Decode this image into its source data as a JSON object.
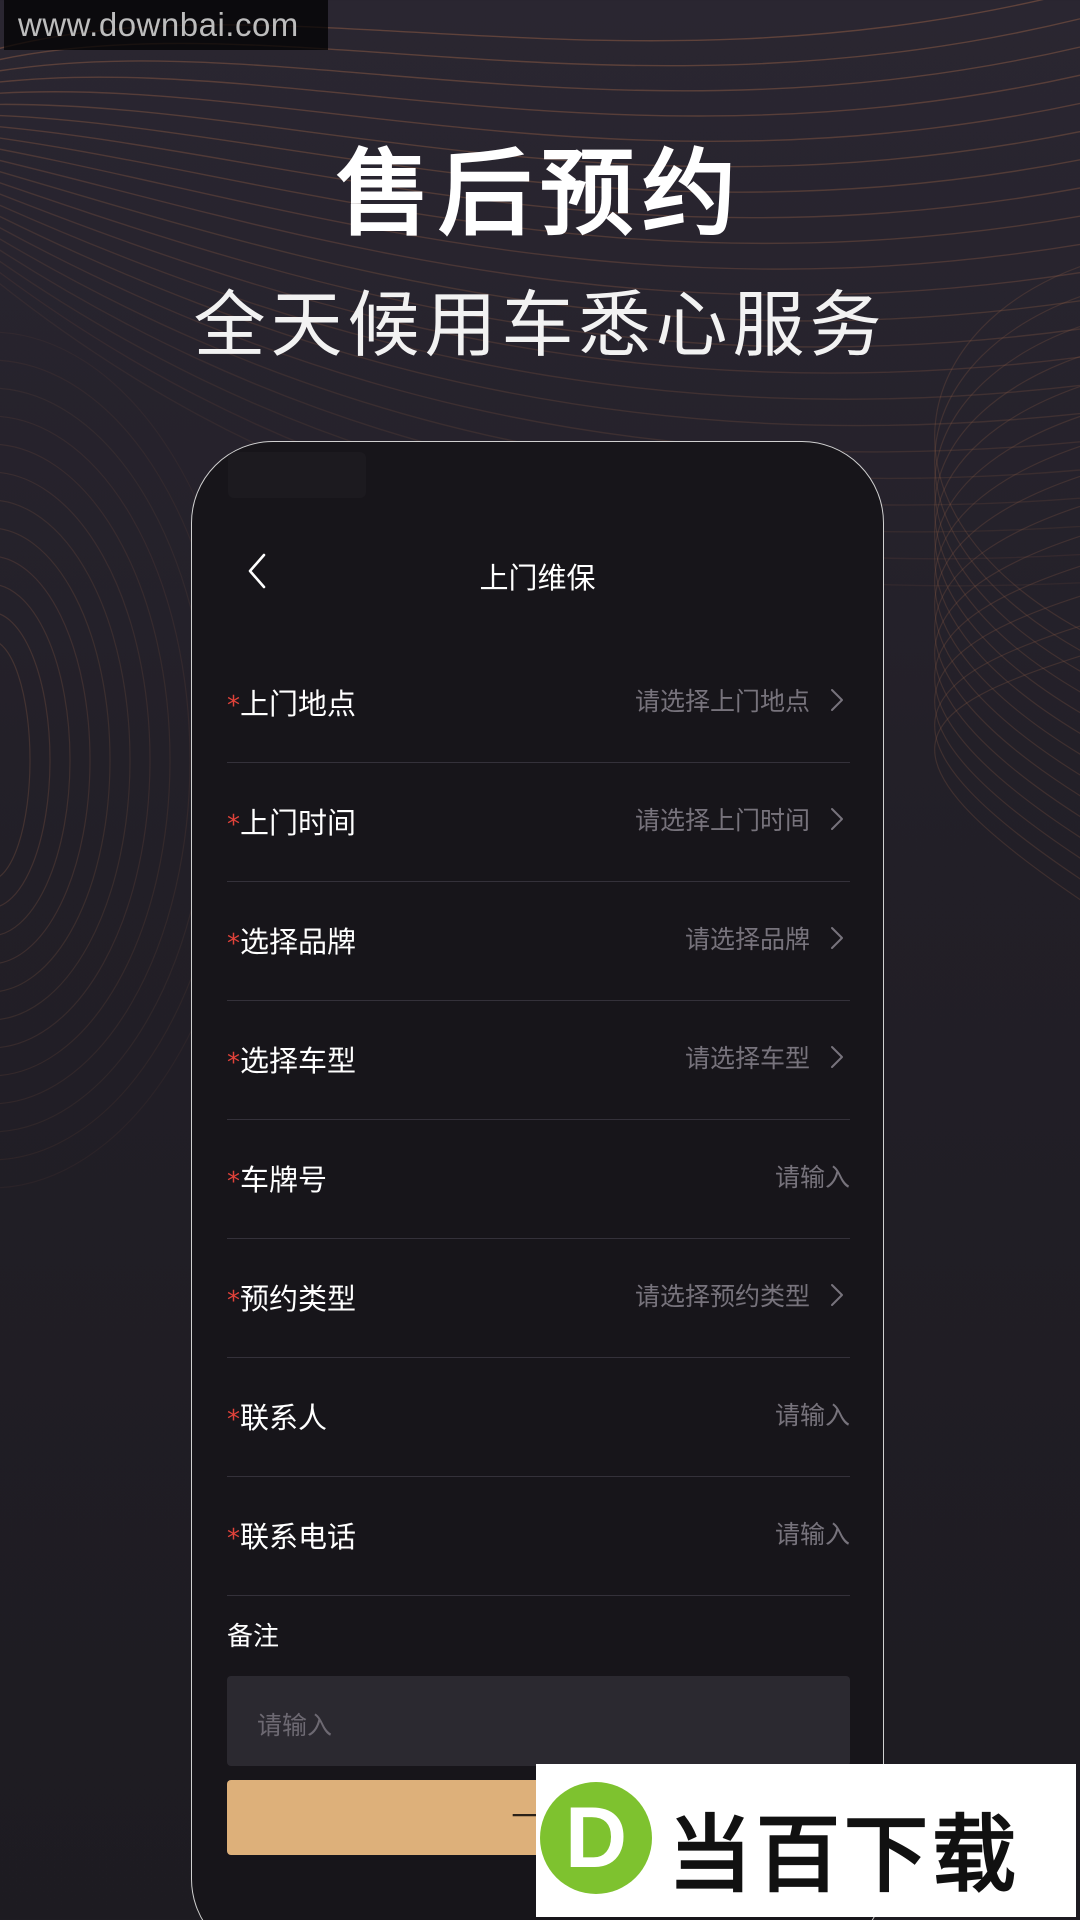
{
  "watermark_top": "www.downbai.com",
  "hero": {
    "title": "售后预约",
    "subtitle": "全天候用车悉心服务"
  },
  "screen": {
    "title": "上门维保",
    "required_mark": "*",
    "fields": [
      {
        "label": "上门地点",
        "placeholder": "请选择上门地点",
        "type": "select"
      },
      {
        "label": "上门时间",
        "placeholder": "请选择上门时间",
        "type": "select"
      },
      {
        "label": "选择品牌",
        "placeholder": "请选择品牌",
        "type": "select"
      },
      {
        "label": "选择车型",
        "placeholder": "请选择车型",
        "type": "select"
      },
      {
        "label": "车牌号",
        "placeholder": "请输入",
        "type": "input"
      },
      {
        "label": "预约类型",
        "placeholder": "请选择预约类型",
        "type": "select"
      },
      {
        "label": "联系人",
        "placeholder": "请输入",
        "type": "input"
      },
      {
        "label": "联系电话",
        "placeholder": "请输入",
        "type": "input"
      }
    ],
    "remark": {
      "label": "备注",
      "placeholder": "请输入"
    },
    "submit_label": "一键"
  },
  "watermark_logo": {
    "letter": "D",
    "text": "当百下载"
  },
  "colors": {
    "accent_button": "#ddb07a",
    "required": "#e0423a",
    "topo_line": "#8a5a44",
    "logo_green": "#7ec22f"
  },
  "icons": {
    "back": "chevron-left-icon",
    "row_arrow": "chevron-right-icon"
  }
}
